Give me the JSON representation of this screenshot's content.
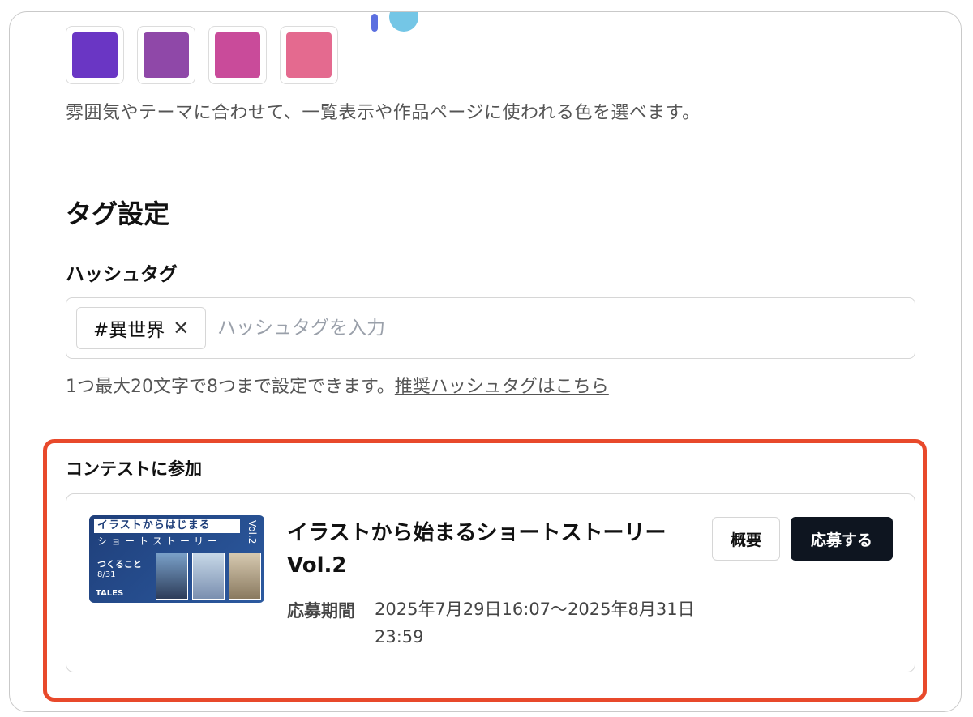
{
  "colors": {
    "swatches": [
      "#6a36c4",
      "#8f48a8",
      "#c94b9a",
      "#e46a8f"
    ],
    "highlight_border": "#e8492b",
    "apply_button_bg": "#0e1520"
  },
  "color_setting": {
    "help_text": "雰囲気やテーマに合わせて、一覧表示や作品ページに使われる色を選べます。"
  },
  "tag_settings": {
    "title": "タグ設定",
    "hashtag_label": "ハッシュタグ",
    "chips": [
      {
        "label": "#異世界",
        "remove_icon": "close-icon"
      }
    ],
    "input_placeholder": "ハッシュタグを入力",
    "help_text": "1つ最大20文字で8つまで設定できます。",
    "help_link": "推奨ハッシュタグはこちら"
  },
  "contest": {
    "section_label": "コンテストに参加",
    "banner": {
      "title_line1": "イラストからはじまる",
      "title_line2": "ショートストーリー",
      "vol": "Vol.2",
      "theme": "つくること",
      "date": "8/31",
      "logo": "TALES"
    },
    "title": "イラストから始まるショートストーリーVol.2",
    "period_label": "応募期間",
    "period_value": "2025年7月29日16:07〜2025年8月31日23:59",
    "overview_button": "概要",
    "apply_button": "応募する"
  }
}
